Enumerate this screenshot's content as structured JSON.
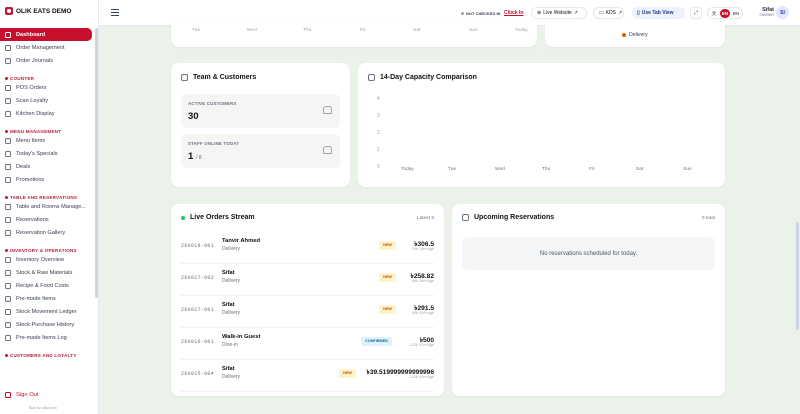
{
  "brand": {
    "name": "OLIK EATS DEMO"
  },
  "sidebar": {
    "dashboard": "Dashboard",
    "order_management": "Order Management",
    "order_journals": "Order Journals",
    "sections": [
      {
        "title": "COUNTER",
        "items": [
          "POS Orders",
          "Scan Loyalty",
          "Kitchen Display"
        ]
      },
      {
        "title": "MENU MANAGEMENT",
        "items": [
          "Menu Items",
          "Today's Specials",
          "Deals",
          "Promotions"
        ]
      },
      {
        "title": "TABLE AND RESERVATIONS",
        "items": [
          "Table and Rooms Manage...",
          "Reservations",
          "Reservation Gallery"
        ]
      },
      {
        "title": "INVENTORY & OPERATIONS",
        "items": [
          "Inventory Overview",
          "Stock & Raw Materials",
          "Recipe & Food Costs",
          "Pre-made Items",
          "Stock Movement Ledger",
          "Stock Purchase History",
          "Pre-made Items Log"
        ]
      },
      {
        "title": "CUSTOMERS AND LOYALTY",
        "items": []
      }
    ],
    "sign_out": "Sign Out",
    "built_by": "Built by olikit.com"
  },
  "topbar": {
    "status": "NOT CHECKED IN",
    "clock_in": "Clock In",
    "live_website": "Live Website",
    "kds": "KDS",
    "tab_view": "Use Tab View",
    "lang_en": "EN",
    "lang_bn": "BN",
    "user_name": "Sifat",
    "user_role": "OWNER",
    "avatar": "SI"
  },
  "top_chart": {
    "days": [
      "Tue",
      "Wed",
      "Thu",
      "Fri",
      "Sat",
      "Sun",
      "Today"
    ]
  },
  "delivery_legend": "Delivery",
  "team": {
    "title": "Team & Customers",
    "active_label": "ACTIVE CUSTOMERS",
    "active_value": "30",
    "staff_label": "STAFF ONLINE TODAY",
    "staff_value": "1",
    "staff_total": "/ 8"
  },
  "capacity": {
    "title": "14-Day Capacity Comparison"
  },
  "chart_data": {
    "type": "line",
    "title": "14-Day Capacity Comparison",
    "categories": [
      "Today",
      "Tue",
      "Wed",
      "Thu",
      "Fri",
      "Sat",
      "Sun"
    ],
    "yticks": [
      "4",
      "3",
      "2",
      "1",
      "0"
    ],
    "ylim": [
      0,
      4
    ],
    "series": [],
    "grid": false
  },
  "orders": {
    "title": "Live Orders Stream",
    "hint": "Latest 5",
    "rows": [
      {
        "id": "260918-001",
        "customer": "Tanvir Ahmed",
        "type": "Delivery",
        "status": "NEW",
        "amount": "৳306.5",
        "ago": "29h 19m ago"
      },
      {
        "id": "260917-002",
        "customer": "Sifat",
        "type": "Delivery",
        "status": "NEW",
        "amount": "৳258.82",
        "ago": "89h 38m ago"
      },
      {
        "id": "260917-001",
        "customer": "Sifat",
        "type": "Delivery",
        "status": "NEW",
        "amount": "৳291.5",
        "ago": "95h 20m ago"
      },
      {
        "id": "260916-001",
        "customer": "Walk-in Guest",
        "type": "Dine-in",
        "status": "CONFIRMED",
        "amount": "৳500",
        "ago": "122h 47m ago"
      },
      {
        "id": "260915-004",
        "customer": "Sifat",
        "type": "Delivery",
        "status": "NEW",
        "amount": "৳39.519999999999996",
        "ago": "131h 40m ago"
      }
    ]
  },
  "reservations": {
    "title": "Upcoming Reservations",
    "hint": "0 total",
    "empty": "No reservations scheduled for today."
  },
  "colors": {
    "brand": "#c8102e",
    "sidebar_active": "#c8102e",
    "background": "#eaf2ea",
    "delivery": "#ea580c"
  }
}
